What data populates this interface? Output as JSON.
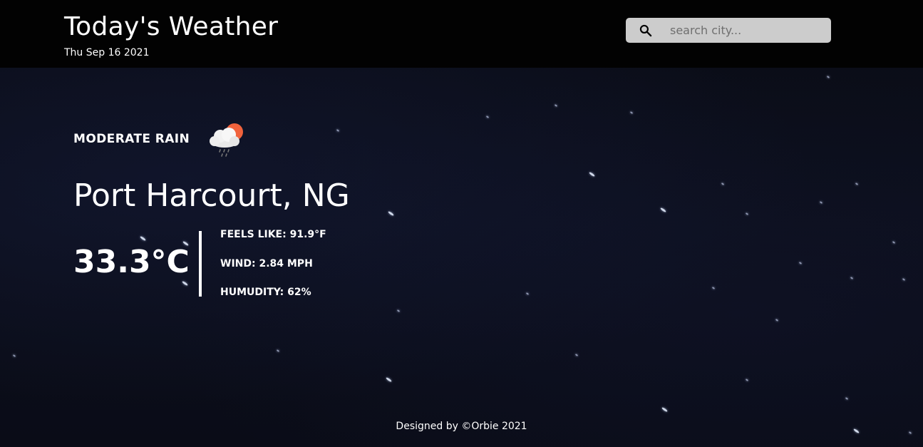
{
  "header": {
    "title": "Today's Weather",
    "date": "Thu Sep 16 2021"
  },
  "search": {
    "placeholder": "search city...",
    "value": "",
    "icon": "search-icon"
  },
  "weather": {
    "condition": "MODERATE RAIN",
    "condition_icon": "rain-cloud-sun-icon",
    "city": "Port Harcourt, NG",
    "temperature": "33.3°C",
    "feels_like": "FEELS LIKE: 91.9°F",
    "wind": "WIND: 2.84 MPH",
    "humidity": "HUMUDITY: 62%"
  },
  "footer": {
    "credit": "Designed by ©Orbie 2021"
  },
  "colors": {
    "header_bg": "#020202",
    "page_bg": "#0b0d18",
    "search_bg": "#cccccc",
    "sun_accent": "#f0623c",
    "text": "#ffffff"
  }
}
